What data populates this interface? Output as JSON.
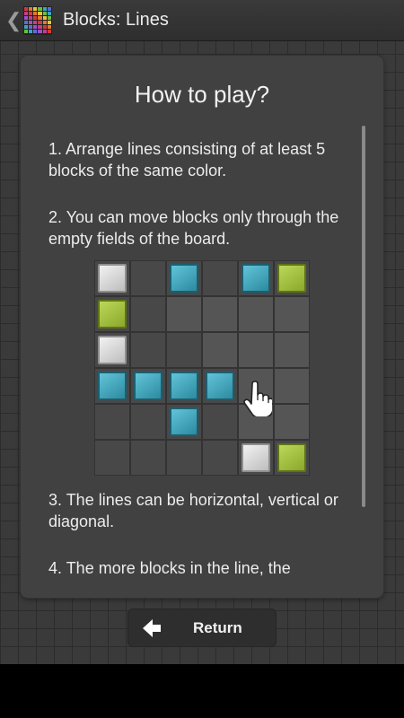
{
  "actionbar": {
    "back_icon": "chevron-left-icon",
    "app_icon": "blocks-grid-icon",
    "title": "Blocks: Lines"
  },
  "help": {
    "heading": "How to play?",
    "rules": [
      "1. Arrange lines consisting of at least 5 blocks of the same color.",
      "2. You can move blocks only through the empty fields of the board.",
      "3. The lines can be horizontal, vertical or diagonal.",
      "4. The more blocks in the line, the"
    ]
  },
  "board_example": {
    "rows": [
      [
        "white",
        "",
        "blue",
        "",
        "blue",
        "green"
      ],
      [
        "green",
        "",
        "",
        "",
        "",
        ""
      ],
      [
        "white",
        "",
        "",
        "",
        "",
        ""
      ],
      [
        "blue",
        "blue",
        "blue",
        "blue",
        "",
        ""
      ],
      [
        "",
        "",
        "blue",
        "",
        "",
        ""
      ],
      [
        "",
        "",
        "",
        "",
        "white",
        "green"
      ]
    ],
    "pointer_icon": "hand-pointer-icon"
  },
  "footer": {
    "return_label": "Return",
    "return_icon": "arrow-left-icon"
  },
  "colors": {
    "blue": "#3aa6be",
    "green": "#a4c23a",
    "white": "#d9d9d9"
  }
}
